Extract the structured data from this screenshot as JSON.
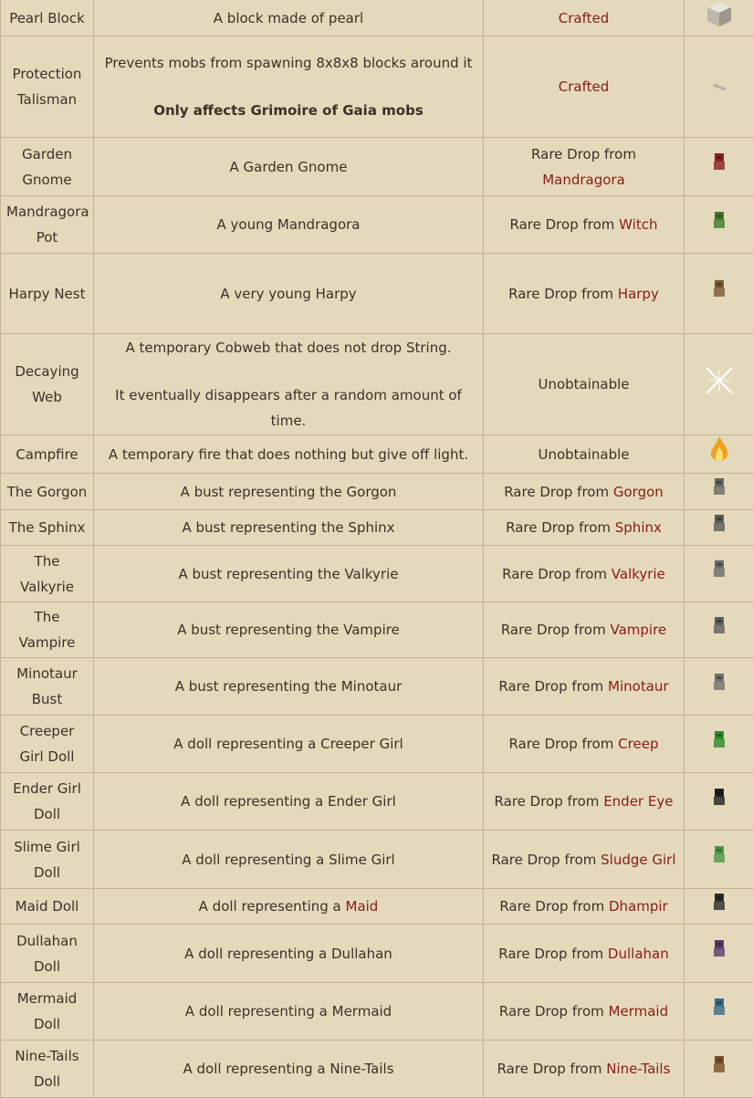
{
  "rows": [
    {
      "name": "Pearl Block",
      "desc": [
        "A block made of pearl"
      ],
      "desc_bold": "",
      "source_prefix": "",
      "source_link": "Crafted",
      "icon": "pearl-block-icon",
      "color": "#cfc9c0",
      "h": 40
    },
    {
      "name": "Protection Talisman",
      "desc": [
        "Prevents mobs from spawning 8x8x8 blocks around it"
      ],
      "desc_bold": "Only affects Grimoire of Gaia mobs",
      "source_prefix": "",
      "source_link": "Crafted",
      "icon": "talisman-icon",
      "color": "#b0b0b0",
      "h": 111
    },
    {
      "name": "Garden Gnome",
      "desc": [
        "A Garden Gnome"
      ],
      "desc_bold": "",
      "source_prefix": "Rare Drop from ",
      "source_link": "Mandragora",
      "icon": "garden-gnome-icon",
      "color": "#8b2020",
      "h": 64
    },
    {
      "name": "Mandragora Pot",
      "desc": [
        "A young Mandragora"
      ],
      "desc_bold": "",
      "source_prefix": "Rare Drop from ",
      "source_link": "Witch",
      "icon": "mandragora-pot-icon",
      "color": "#3f7a2a",
      "h": 63
    },
    {
      "name": "Harpy Nest",
      "desc": [
        "A very young Harpy"
      ],
      "desc_bold": "",
      "source_prefix": "Rare Drop from ",
      "source_link": "Harpy",
      "icon": "harpy-nest-icon",
      "color": "#7a5a35",
      "h": 88
    },
    {
      "name": "Decaying Web",
      "desc": [
        "A temporary Cobweb that does not drop String.",
        "It eventually disappears after a random amount of time."
      ],
      "desc_bold": "",
      "source_prefix": "Unobtainable",
      "source_link": "",
      "icon": "cobweb-icon",
      "color": "#f2f2f2",
      "h": 111
    },
    {
      "name": "Campfire",
      "desc": [
        "A temporary fire that does nothing but give off light."
      ],
      "desc_bold": "",
      "source_prefix": "Unobtainable",
      "source_link": "",
      "icon": "fire-icon",
      "color": "#f0a020",
      "h": 40
    },
    {
      "name": "The Gorgon",
      "desc": [
        "A bust representing the Gorgon"
      ],
      "desc_bold": "",
      "source_prefix": "Rare Drop from ",
      "source_link": "Gorgon",
      "icon": "gorgon-bust-icon",
      "color": "#666666",
      "h": 40
    },
    {
      "name": "The Sphinx",
      "desc": [
        "A bust representing the Sphinx"
      ],
      "desc_bold": "",
      "source_prefix": "Rare Drop from ",
      "source_link": "Sphinx",
      "icon": "sphinx-bust-icon",
      "color": "#5a5a5a",
      "h": 39
    },
    {
      "name": "The Valkyrie",
      "desc": [
        "A bust representing the Valkyrie"
      ],
      "desc_bold": "",
      "source_prefix": "Rare Drop from ",
      "source_link": "Valkyrie",
      "icon": "valkyrie-bust-icon",
      "color": "#6a6a6a",
      "h": 62
    },
    {
      "name": "The Vampire",
      "desc": [
        "A bust representing the Vampire"
      ],
      "desc_bold": "",
      "source_prefix": "Rare Drop from ",
      "source_link": "Vampire",
      "icon": "vampire-bust-icon",
      "color": "#5e5e5e",
      "h": 61
    },
    {
      "name": "Minotaur Bust",
      "desc": [
        "A bust representing the Minotaur"
      ],
      "desc_bold": "",
      "source_prefix": "Rare Drop from ",
      "source_link": "Minotaur",
      "icon": "minotaur-bust-icon",
      "color": "#707070",
      "h": 63
    },
    {
      "name": "Creeper Girl Doll",
      "desc": [
        "A doll representing a Creeper Girl"
      ],
      "desc_bold": "",
      "source_prefix": "Rare Drop from ",
      "source_link": "Creep",
      "icon": "creeper-girl-doll-icon",
      "color": "#2f8a2f",
      "h": 63
    },
    {
      "name": "Ender Girl Doll",
      "desc": [
        "A doll representing a Ender Girl"
      ],
      "desc_bold": "",
      "source_prefix": "Rare Drop from ",
      "source_link": "Ender Eye",
      "icon": "ender-girl-doll-icon",
      "color": "#1e1e1e",
      "h": 63
    },
    {
      "name": "Slime Girl Doll",
      "desc": [
        "A doll representing a Slime Girl"
      ],
      "desc_bold": "",
      "source_prefix": "Rare Drop from ",
      "source_link": "Sludge Girl",
      "icon": "slime-girl-doll-icon",
      "color": "#4a9a4a",
      "h": 64
    },
    {
      "name": "Maid Doll",
      "desc": [
        "A doll representing a "
      ],
      "desc_link": "Maid",
      "desc_bold": "",
      "source_prefix": "Rare Drop from ",
      "source_link": "Dhampir",
      "icon": "maid-doll-icon",
      "color": "#2a2a2a",
      "h": 39
    },
    {
      "name": "Dullahan Doll",
      "desc": [
        "A doll representing a Dullahan"
      ],
      "desc_bold": "",
      "source_prefix": "Rare Drop from ",
      "source_link": "Dullahan",
      "icon": "dullahan-doll-icon",
      "color": "#5a3a6a",
      "h": 64
    },
    {
      "name": "Mermaid Doll",
      "desc": [
        "A doll representing a Mermaid"
      ],
      "desc_bold": "",
      "source_prefix": "Rare Drop from ",
      "source_link": "Mermaid",
      "icon": "mermaid-doll-icon",
      "color": "#3a6a8a",
      "h": 63
    },
    {
      "name": "Nine-Tails Doll",
      "desc": [
        "A doll representing a Nine-Tails"
      ],
      "desc_bold": "",
      "source_prefix": "Rare Drop from ",
      "source_link": "Nine-Tails",
      "icon": "nine-tails-doll-icon",
      "color": "#7a5030",
      "h": 63
    }
  ]
}
